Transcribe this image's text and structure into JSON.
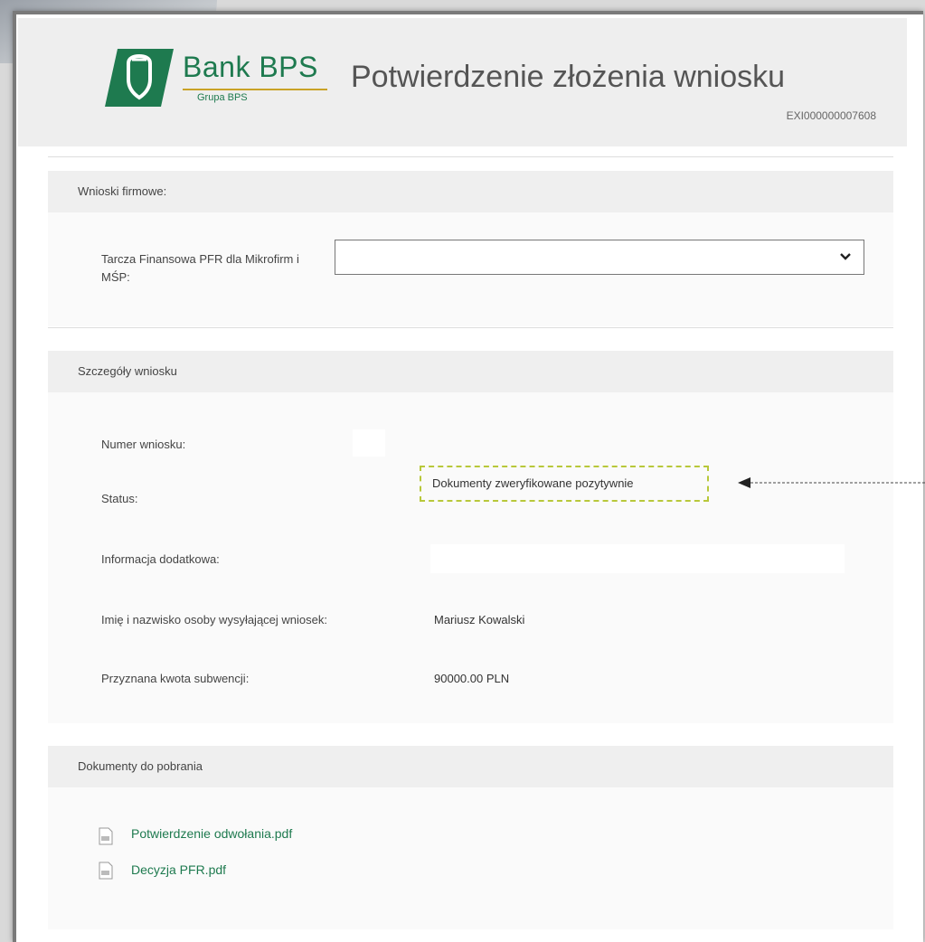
{
  "header": {
    "logo_name": "Bank BPS",
    "logo_sub": "Grupa BPS",
    "title": "Potwierdzenie złożenia wniosku",
    "app_number": "EXI000000007608"
  },
  "company_section": {
    "heading": "Wnioski firmowe:",
    "select_label": "Tarcza Finansowa PFR dla Mikrofirm i MŚP:",
    "select_value": ""
  },
  "details": {
    "heading": "Szczegóły wniosku",
    "rows": [
      {
        "label": "Numer wniosku:",
        "value": ""
      },
      {
        "label": "Status:",
        "value": "Dokumenty zweryfikowane pozytywnie"
      },
      {
        "label": "Informacja dodatkowa:",
        "value": ""
      },
      {
        "label": "Imię i nazwisko osoby wysyłającej wniosek:",
        "value": "Mariusz Kowalski"
      },
      {
        "label": "Przyznana kwota subwencji:",
        "value": "90000.00 PLN"
      }
    ]
  },
  "documents": {
    "heading": "Dokumenty do pobrania",
    "files": [
      {
        "name": "Potwierdzenie odwołania.pdf",
        "icon": "pdf-file-icon"
      },
      {
        "name": "Decyzja PFR.pdf",
        "icon": "pdf-file-icon"
      }
    ]
  },
  "colors": {
    "brand_green": "#1e7a4f",
    "highlight_dashed": "#b8c83a",
    "section_gray": "#efefef"
  }
}
